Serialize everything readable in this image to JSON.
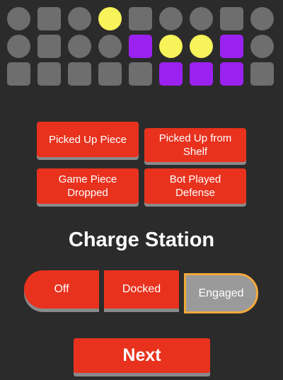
{
  "colors": {
    "empty": "#6e6e6e",
    "cone": "#f7f35a",
    "cube": "#9b21f0",
    "accent": "#e8321e",
    "selected_border": "#f2a93b"
  },
  "grid": {
    "rows": [
      {
        "cells": [
          {
            "shape": "cone",
            "state": "empty"
          },
          {
            "shape": "cube",
            "state": "empty"
          },
          {
            "shape": "cone",
            "state": "empty"
          },
          {
            "shape": "cone",
            "state": "cone"
          },
          {
            "shape": "cube",
            "state": "empty"
          },
          {
            "shape": "cone",
            "state": "empty"
          },
          {
            "shape": "cone",
            "state": "empty"
          },
          {
            "shape": "cube",
            "state": "empty"
          },
          {
            "shape": "cone",
            "state": "empty"
          }
        ]
      },
      {
        "cells": [
          {
            "shape": "cone",
            "state": "empty"
          },
          {
            "shape": "cube",
            "state": "empty"
          },
          {
            "shape": "cone",
            "state": "empty"
          },
          {
            "shape": "cone",
            "state": "empty"
          },
          {
            "shape": "cube",
            "state": "cube"
          },
          {
            "shape": "cone",
            "state": "cone"
          },
          {
            "shape": "cone",
            "state": "cone"
          },
          {
            "shape": "cube",
            "state": "cube"
          },
          {
            "shape": "cone",
            "state": "empty"
          }
        ]
      },
      {
        "cells": [
          {
            "shape": "hybrid",
            "state": "empty"
          },
          {
            "shape": "hybrid",
            "state": "empty"
          },
          {
            "shape": "hybrid",
            "state": "empty"
          },
          {
            "shape": "hybrid",
            "state": "empty"
          },
          {
            "shape": "hybrid",
            "state": "empty"
          },
          {
            "shape": "hybrid",
            "state": "cube"
          },
          {
            "shape": "hybrid",
            "state": "cube"
          },
          {
            "shape": "hybrid",
            "state": "cube"
          },
          {
            "shape": "hybrid",
            "state": "empty"
          }
        ]
      }
    ]
  },
  "events": {
    "picked_up_piece": "Picked Up Piece",
    "picked_up_from_shelf": "Picked Up from Shelf",
    "game_piece_dropped": "Game Piece Dropped",
    "bot_played_defense": "Bot Played Defense"
  },
  "charge_station": {
    "title": "Charge Station",
    "options": [
      "Off",
      "Docked",
      "Engaged"
    ],
    "selected": "Engaged"
  },
  "next_label": "Next"
}
